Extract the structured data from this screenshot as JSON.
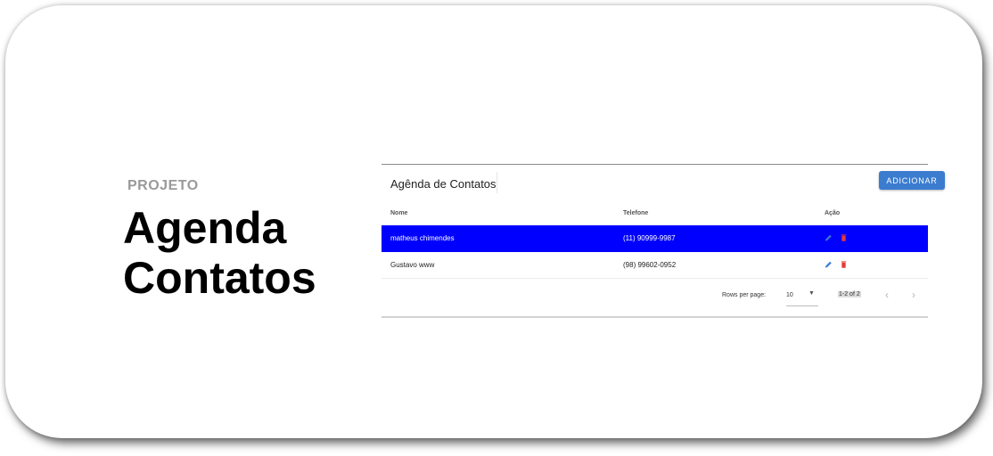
{
  "hero": {
    "eyebrow": "PROJETO",
    "title_line1": "Agenda",
    "title_line2": "Contatos"
  },
  "panel": {
    "title": "Agênda de Contatos",
    "add_label": "ADICIONAR",
    "columns": [
      "Nome",
      "Telefone",
      "Ação"
    ],
    "rows": [
      {
        "name": "matheus chimendes",
        "phone": "(11) 90999-9987",
        "selected": true
      },
      {
        "name": "Gustavo www",
        "phone": "(98) 99602-0952",
        "selected": false
      }
    ],
    "footer": {
      "rows_per_page_label": "Rows per page:",
      "rows_per_page_value": "10",
      "range": "1-2 of 2"
    }
  },
  "colors": {
    "accent": "#3b7ccf",
    "selected_row": "#0000ff",
    "edit_icon": "#3b7ccf",
    "delete_icon": "#e53935"
  },
  "icons": {
    "edit": "pencil-icon",
    "delete": "trash-icon",
    "prev": "chevron-left-icon",
    "next": "chevron-right-icon",
    "dropdown": "caret-down-icon"
  }
}
